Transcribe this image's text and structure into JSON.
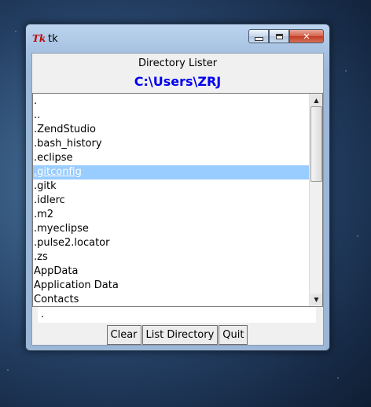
{
  "window": {
    "icon_text": "Tk",
    "title": "tk"
  },
  "heading": "Directory Lister",
  "path": "C:\\Users\\ZRJ",
  "listing": {
    "items": [
      ".",
      "..",
      ".ZendStudio",
      ".bash_history",
      ".eclipse",
      ".gitconfig",
      ".gitk",
      ".idlerc",
      ".m2",
      ".myeclipse",
      ".pulse2.locator",
      ".zs",
      "AppData",
      "Application Data",
      "Contacts"
    ],
    "selected": ".gitconfig"
  },
  "entry": {
    "value": "."
  },
  "buttons": {
    "clear": "Clear",
    "list": "List Directory",
    "quit": "Quit"
  },
  "colors": {
    "path_blue": "#0000ee",
    "selection": "#99ccff",
    "close_red": "#c23c22"
  }
}
